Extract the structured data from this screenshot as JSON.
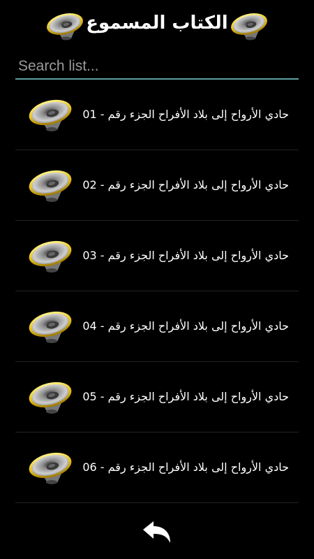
{
  "header": {
    "title": "الكتاب المسموع",
    "icon": "speaker-icon",
    "accent": "#e8c21a"
  },
  "search": {
    "placeholder": "Search list...",
    "value": "",
    "underline": "#5f9ea0"
  },
  "items": [
    {
      "label": "حادي الأرواح إلى بلاد الأفراح الجزء رقم - 01",
      "icon": "speaker-icon"
    },
    {
      "label": "حادي الأرواح إلى بلاد الأفراح الجزء رقم - 02",
      "icon": "speaker-icon"
    },
    {
      "label": "حادي الأرواح إلى بلاد الأفراح الجزء رقم - 03",
      "icon": "speaker-icon"
    },
    {
      "label": "حادي الأرواح إلى بلاد الأفراح الجزء رقم - 04",
      "icon": "speaker-icon"
    },
    {
      "label": "حادي الأرواح إلى بلاد الأفراح الجزء رقم - 05",
      "icon": "speaker-icon"
    },
    {
      "label": "حادي الأرواح إلى بلاد الأفراح الجزء رقم - 06",
      "icon": "speaker-icon"
    }
  ],
  "footer": {
    "icon": "back-arrow-icon"
  }
}
